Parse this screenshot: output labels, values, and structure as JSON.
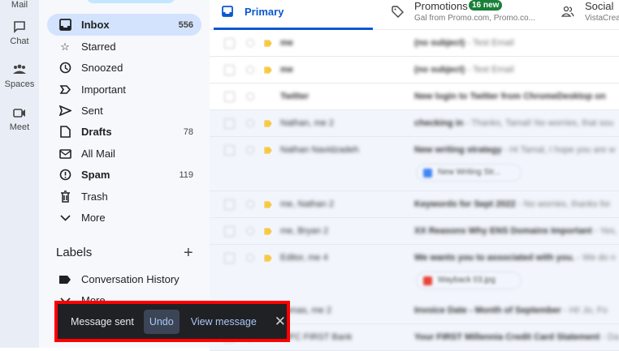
{
  "rail": [
    {
      "label": "Mail"
    },
    {
      "label": "Chat"
    },
    {
      "label": "Spaces"
    },
    {
      "label": "Meet"
    }
  ],
  "sidebar": {
    "items": [
      {
        "label": "Inbox",
        "count": "556",
        "icon": "inbox-icon"
      },
      {
        "label": "Starred",
        "icon": "star-icon"
      },
      {
        "label": "Snoozed",
        "icon": "clock-icon"
      },
      {
        "label": "Important",
        "icon": "important-icon"
      },
      {
        "label": "Sent",
        "icon": "send-icon"
      },
      {
        "label": "Drafts",
        "count": "78",
        "icon": "draft-icon"
      },
      {
        "label": "All Mail",
        "icon": "mail-icon"
      },
      {
        "label": "Spam",
        "count": "119",
        "icon": "spam-icon"
      },
      {
        "label": "Trash",
        "icon": "trash-icon"
      },
      {
        "label": "More",
        "icon": "chevron-down-icon"
      }
    ],
    "labels_title": "Labels",
    "labels": [
      {
        "label": "Conversation History"
      },
      {
        "label": "More"
      }
    ]
  },
  "tabs": {
    "primary": "Primary",
    "promotions": "Promotions",
    "promotions_badge": "16 new",
    "promotions_sub": "Gal from Promo.com, Promo.co...",
    "social": "Social",
    "social_sub": "VistaCrea"
  },
  "emails": [
    {
      "sender": "me",
      "subject": "(no subject)",
      "snippet": " - Test Email",
      "read": true
    },
    {
      "sender": "me",
      "subject": "(no subject)",
      "snippet": " - Test Email",
      "read": true
    },
    {
      "sender": "Twitter",
      "subject": "New login to Twitter from ChromeDesktop on",
      "snippet": "",
      "read": true
    },
    {
      "sender": "Nathan, me 2",
      "subject": "checking in",
      "snippet": " - Thanks, Tamal! No worries, that sou",
      "read": false
    },
    {
      "sender": "Nathan Navidzadeh",
      "subject": "New writing strategy",
      "snippet": " - Hi Tamal, I hope you are w",
      "read": false,
      "attachment": "New Writing Str...",
      "attachment_color": "#4285f4"
    },
    {
      "sender": "me, Nathan 2",
      "subject": "Keywords for Sept 2022",
      "snippet": " - No worries, thanks for",
      "read": false
    },
    {
      "sender": "me, Bryan 2",
      "subject": "XX Reasons Why ENS Domains Important",
      "snippet": " - Yes,",
      "read": false
    },
    {
      "sender": "Editor, me 4",
      "subject": "We wants you to associated with you.",
      "snippet": " - We do n",
      "read": false,
      "attachment": "Wayback 03.jpg",
      "attachment_color": "#ea4335"
    },
    {
      "sender": "Tamas, me 2",
      "subject": "Invoice Date - Month of September",
      "snippet": " - Hi! Jo, Fo",
      "read": false
    },
    {
      "sender": "IDFC FIRST Bank",
      "subject": "Your FIRST Millennia Credit Card Statement",
      "snippet": " - Da",
      "read": false
    }
  ],
  "toast": {
    "message": "Message sent",
    "undo": "Undo",
    "view": "View message"
  }
}
